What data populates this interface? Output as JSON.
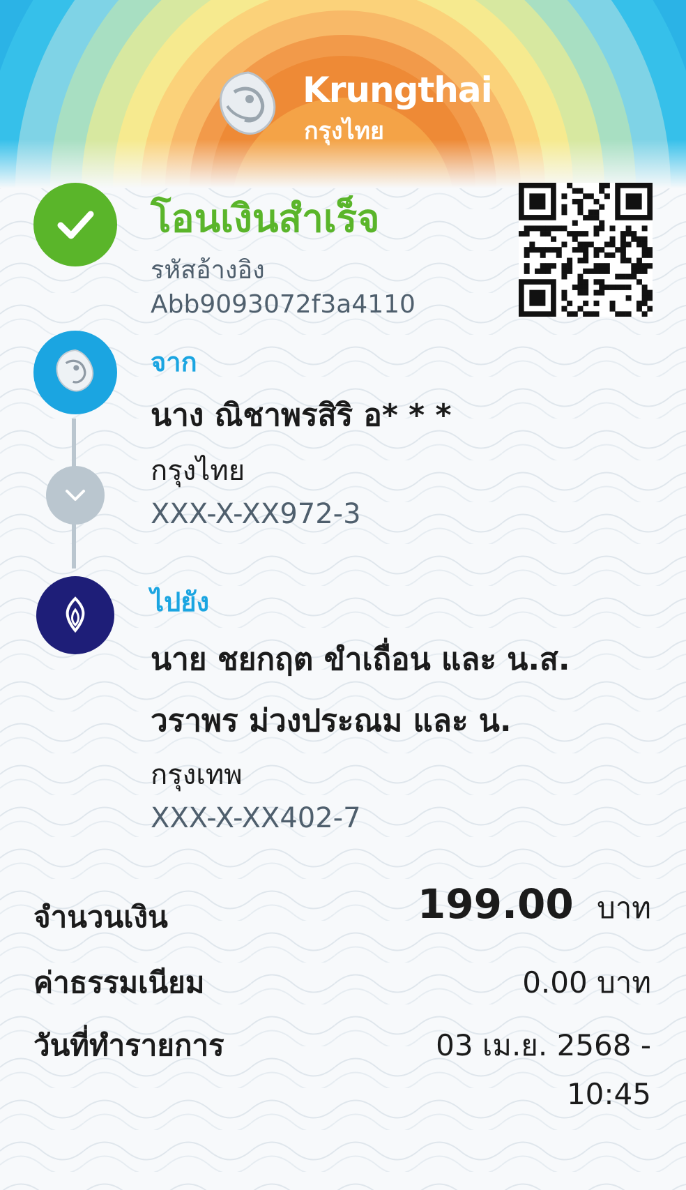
{
  "brand": {
    "name_en": "Krungthai",
    "name_th": "กรุงไทย"
  },
  "status": {
    "title": "โอนเงินสำเร็จ",
    "ref_label": "รหัสอ้างอิง",
    "ref_value": "Abb9093072f3a4110"
  },
  "from": {
    "label": "จาก",
    "name": "นาง ณิชาพรสิริ อ* * *",
    "bank": "กรุงไทย",
    "account": "XXX-X-XX972-3"
  },
  "to": {
    "label": "ไปยัง",
    "name_line1": "นาย ชยกฤต ขำเถื่อน และ น.ส.",
    "name_line2": "วราพร ม่วงประณม และ น.",
    "bank": "กรุงเทพ",
    "account": "XXX-X-XX402-7"
  },
  "details": {
    "amount_label": "จำนวนเงิน",
    "amount_value": "199.00",
    "amount_unit": "บาท",
    "fee_label": "ค่าธรรมเนียม",
    "fee_value": "0.00 บาท",
    "date_label": "วันที่ทำรายการ",
    "date_value": "03 เม.ย. 2568 -",
    "time_value": "10:45"
  },
  "colors": {
    "success_green": "#5ab52a",
    "accent_blue": "#1ba5e1",
    "bbl_navy": "#1e1e78",
    "timeline_grey": "#bac6cf"
  },
  "icons": [
    "check-icon",
    "krungthai-logo-icon",
    "chevron-down-icon",
    "bangkok-bank-logo-icon",
    "qr-code-icon"
  ]
}
